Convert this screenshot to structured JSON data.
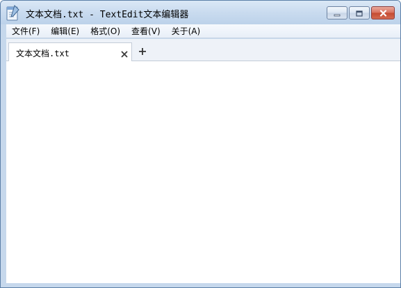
{
  "window": {
    "title": "文本文档.txt - TextEdit文本编辑器"
  },
  "menu": {
    "items": [
      {
        "label": "文件(F)"
      },
      {
        "label": "编辑(E)"
      },
      {
        "label": "格式(O)"
      },
      {
        "label": "查看(V)"
      },
      {
        "label": "关于(A)"
      }
    ]
  },
  "tabs": [
    {
      "label": "文本文档.txt",
      "active": true
    }
  ],
  "editor": {
    "content": ""
  },
  "icons": {
    "app": "notepad-icon",
    "minimize": "minimize-icon",
    "maximize": "maximize-icon",
    "close": "close-icon",
    "tab_close": "tab-close-icon",
    "add_tab": "plus-icon"
  },
  "colors": {
    "titlebar": "#c9dbef",
    "frame": "#c6d8ec",
    "close_button": "#c44b32",
    "menubar": "#eef3fa",
    "editor_bg": "#ffffff"
  }
}
